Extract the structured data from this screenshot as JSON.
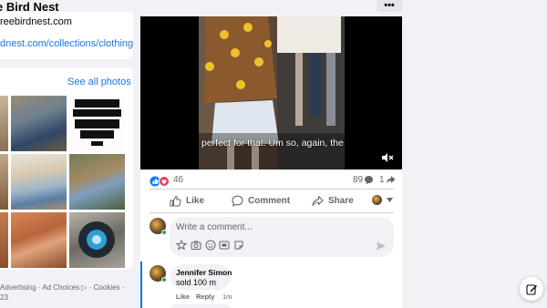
{
  "header": {
    "page_title": "e Bird Nest",
    "more_label": "•••"
  },
  "intro": {
    "email": "reebirdnest.com",
    "website": "dnest.com/collections/clothing"
  },
  "photos": {
    "see_all_label": "See all photos"
  },
  "footer": {
    "links": "Advertising · Ad Choices ▷ · Cookies ·",
    "year": "23"
  },
  "post": {
    "video_caption": "perfect for that. Um so, again, the",
    "reaction_count": "46",
    "comment_count": "89",
    "share_count": "1",
    "actions": {
      "like": "Like",
      "comment": "Comment",
      "share": "Share"
    },
    "comment_placeholder": "Write a comment..."
  },
  "comments": [
    {
      "author": "Jennifer Simon",
      "text": "sold 100 m",
      "like": "Like",
      "reply": "Reply",
      "time": "1m"
    }
  ],
  "colors": {
    "link": "#1b74e4",
    "thread": "#1b74e4",
    "like_blue": "#1877f2",
    "love_red": "#f33e58"
  },
  "icons": [
    "like-reaction-icon",
    "love-reaction-icon",
    "comment-bubble-icon",
    "share-arrow-icon",
    "mute-icon",
    "thumbs-up-icon",
    "chat-icon",
    "share-icon",
    "sticker-icon",
    "gif-icon",
    "emoji-icon",
    "camera-icon",
    "avatar-sticker-icon",
    "send-icon",
    "compose-icon"
  ]
}
